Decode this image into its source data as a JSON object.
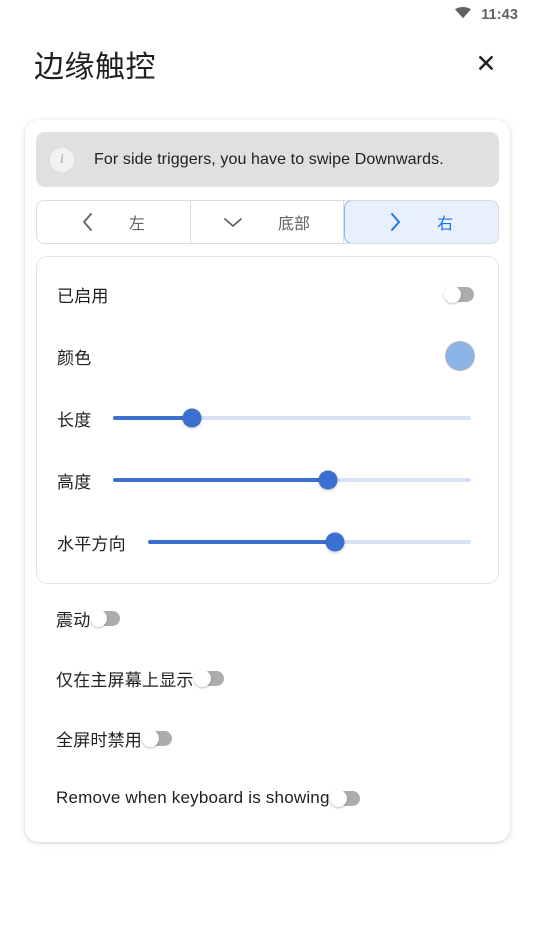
{
  "status_bar": {
    "wifi_icon": "wifi-icon",
    "time": "11:43"
  },
  "header": {
    "title": "边缘触控",
    "close_label": "✕",
    "close_icon": "close-icon"
  },
  "info_banner": {
    "icon": "info-icon",
    "icon_glyph": "i",
    "text": "For side triggers, you have to swipe Downwards."
  },
  "segmented_control": {
    "segments": [
      {
        "label": "左",
        "icon": "chevron-left-icon",
        "selected": false
      },
      {
        "label": "底部",
        "icon": "chevron-down-icon",
        "selected": false
      },
      {
        "label": "右",
        "icon": "chevron-right-icon",
        "selected": true
      }
    ],
    "selected_value": "右"
  },
  "settings_card": {
    "enabled": {
      "label": "已启用",
      "value": "off"
    },
    "color": {
      "label": "颜色",
      "swatch_hex": "#8ab4e8"
    },
    "sliders": [
      {
        "label": "长度",
        "percent": 22
      },
      {
        "label": "高度",
        "percent": 60
      },
      {
        "label": "水平方向",
        "percent": 58
      }
    ]
  },
  "options": [
    {
      "label": "震动",
      "value": "off"
    },
    {
      "label": "仅在主屏幕上显示",
      "value": "off"
    },
    {
      "label": "全屏时禁用",
      "value": "off"
    },
    {
      "label": "Remove when keyboard is showing",
      "value": "off"
    }
  ],
  "colors": {
    "accent": "#1a73e8",
    "slider_fill": "#3b6fd0",
    "slider_track": "#d7e2f7",
    "selected_segment_bg": "#e8f0fe",
    "banner_bg": "#e0e0e0"
  }
}
